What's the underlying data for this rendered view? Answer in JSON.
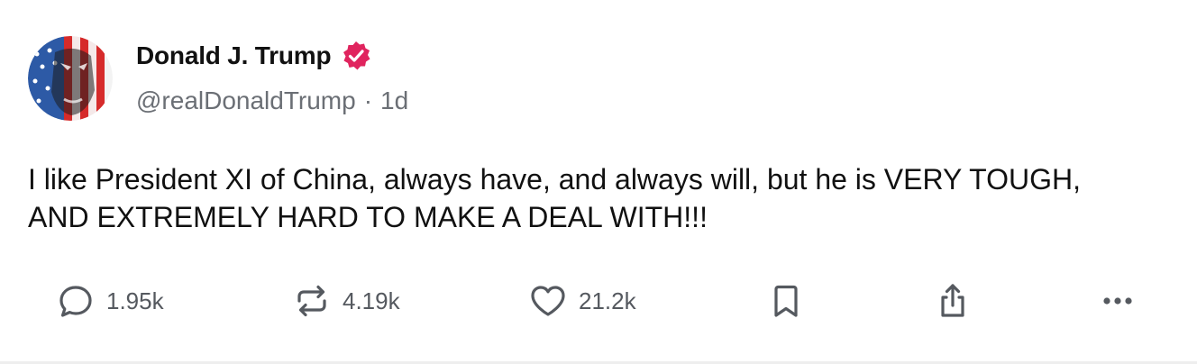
{
  "post": {
    "author": {
      "display_name": "Donald J. Trump",
      "handle": "@realDonaldTrump",
      "verified": true,
      "verified_color": "#e0245e"
    },
    "separator": "·",
    "timestamp": "1d",
    "text": "I like President XI of China, always have, and always will, but he is VERY TOUGH, AND EXTREMELY HARD TO MAKE A DEAL WITH!!!",
    "actions": {
      "reply": {
        "icon": "reply-icon",
        "count": "1.95k"
      },
      "repost": {
        "icon": "repost-icon",
        "count": "4.19k"
      },
      "like": {
        "icon": "heart-icon",
        "count": "21.2k"
      },
      "bookmark": {
        "icon": "bookmark-icon"
      },
      "share": {
        "icon": "share-icon"
      },
      "more": {
        "icon": "more-icon"
      }
    }
  },
  "colors": {
    "text": "#111111",
    "muted": "#6b6f75",
    "icon": "#55595f",
    "verified_badge": "#e0245e"
  }
}
